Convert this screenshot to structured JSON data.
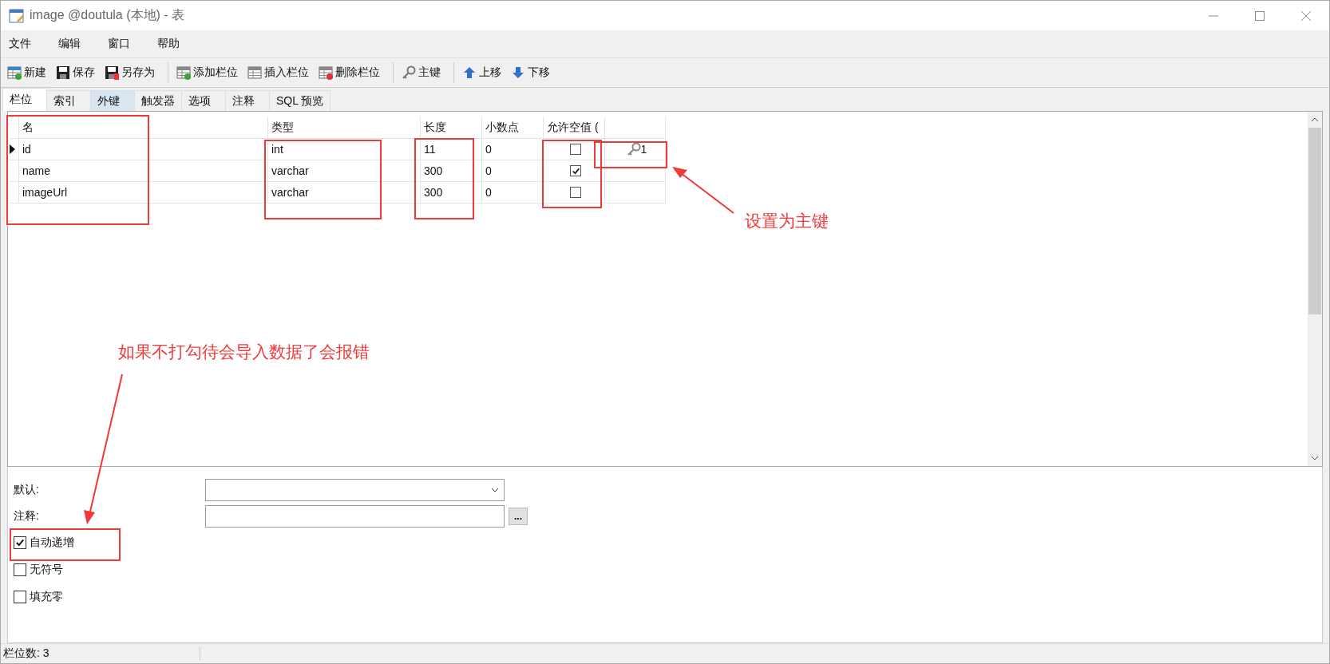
{
  "window": {
    "title": "image @doutula (本地) - 表"
  },
  "menu": [
    "文件",
    "编辑",
    "窗口",
    "帮助"
  ],
  "toolbar": [
    [
      {
        "label": "新建",
        "kind": "new"
      },
      {
        "label": "保存",
        "kind": "save"
      },
      {
        "label": "另存为",
        "kind": "saveas"
      }
    ],
    [
      {
        "label": "添加栏位",
        "kind": "add"
      },
      {
        "label": "插入栏位",
        "kind": "insert"
      },
      {
        "label": "删除栏位",
        "kind": "delete"
      }
    ],
    [
      {
        "label": "主键",
        "kind": "key"
      }
    ],
    [
      {
        "label": "上移",
        "kind": "up"
      },
      {
        "label": "下移",
        "kind": "down"
      }
    ]
  ],
  "tabs": [
    {
      "label": "栏位",
      "selected": true,
      "hovered": false
    },
    {
      "label": "索引",
      "selected": false,
      "hovered": false
    },
    {
      "label": "外键",
      "selected": false,
      "hovered": true
    },
    {
      "label": "触发器",
      "selected": false,
      "hovered": false
    },
    {
      "label": "选项",
      "selected": false,
      "hovered": false
    },
    {
      "label": "注释",
      "selected": false,
      "hovered": false
    },
    {
      "label": "SQL 预览",
      "selected": false,
      "hovered": false
    }
  ],
  "table": {
    "columns": [
      "名",
      "类型",
      "长度",
      "小数点",
      "允许空值 ("
    ],
    "rows": [
      {
        "current": true,
        "name": "id",
        "type": "int",
        "length": "11",
        "decimals": "0",
        "allow_null": false,
        "key": "1"
      },
      {
        "current": false,
        "name": "name",
        "type": "varchar",
        "length": "300",
        "decimals": "0",
        "allow_null": true
      },
      {
        "current": false,
        "name": "imageUrl",
        "type": "varchar",
        "length": "300",
        "decimals": "0",
        "allow_null": false
      }
    ]
  },
  "fields": [
    {
      "label": "默认:",
      "kind": "dropdown"
    },
    {
      "label": "注释:",
      "kind": "text",
      "button": "..."
    }
  ],
  "options": [
    {
      "label": "自动递增",
      "checked": true
    },
    {
      "label": "无符号",
      "checked": false
    },
    {
      "label": "填充零",
      "checked": false
    }
  ],
  "status_bar": {
    "text": "栏位数: 3"
  },
  "annotations": [
    {
      "text": "设置为主键"
    },
    {
      "text": "如果不打勾待会导入数据了会报错"
    }
  ]
}
